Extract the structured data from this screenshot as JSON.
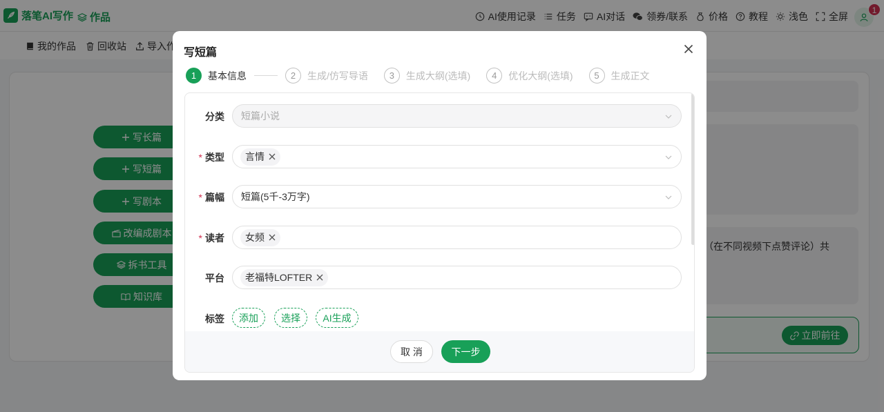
{
  "app": {
    "brand_name": "落笔AI写作",
    "works_label": "作品",
    "accent_color": "#18a058"
  },
  "topnav": {
    "items": [
      {
        "label": "AI使用记录",
        "icon": "clock-icon"
      },
      {
        "label": "任务",
        "icon": "list-icon"
      },
      {
        "label": "AI对话",
        "icon": "chat-icon"
      },
      {
        "label": "领券/联系",
        "icon": "wechat-icon"
      },
      {
        "label": "价格",
        "icon": "money-bag-icon"
      },
      {
        "label": "教程",
        "icon": "help-icon"
      },
      {
        "label": "浅色",
        "icon": "sun-icon"
      },
      {
        "label": "全屏",
        "icon": "fullscreen-icon"
      }
    ],
    "notification_count": "1"
  },
  "subbar": {
    "items": [
      {
        "label": "我的作品",
        "icon": "book-icon"
      },
      {
        "label": "回收站",
        "icon": "trash-icon"
      },
      {
        "label": "导入作",
        "icon": "upload-icon"
      }
    ]
  },
  "sidebar": {
    "buttons": [
      {
        "label": "写长篇",
        "icon": "plus-icon"
      },
      {
        "label": "写短篇",
        "icon": "plus-icon"
      },
      {
        "label": "写剧本",
        "icon": "plus-icon"
      },
      {
        "label": "改编成剧本",
        "icon": "clapper-icon"
      },
      {
        "label": "拆书工具",
        "icon": "layers-icon"
      },
      {
        "label": "知识库",
        "icon": "open-book-icon"
      }
    ]
  },
  "background": {
    "partial_text": "（在不同视频下点赞评论）共",
    "go_button": "立即前往"
  },
  "modal": {
    "title": "写短篇",
    "steps": [
      {
        "num": "1",
        "label": "基本信息",
        "active": true
      },
      {
        "num": "2",
        "label": "生成/仿写导语",
        "active": false
      },
      {
        "num": "3",
        "label": "生成大纲(选填)",
        "active": false
      },
      {
        "num": "4",
        "label": "优化大纲(选填)",
        "active": false
      },
      {
        "num": "5",
        "label": "生成正文",
        "active": false
      }
    ],
    "form": {
      "category": {
        "label": "分类",
        "value": "短篇小说"
      },
      "type": {
        "label": "类型",
        "required_mark": "*",
        "tag": "言情"
      },
      "length": {
        "label": "篇幅",
        "required_mark": "*",
        "value": "短篇(5千-3万字)"
      },
      "reader": {
        "label": "读者",
        "required_mark": "*",
        "tag": "女频"
      },
      "platform": {
        "label": "平台",
        "tag": "老福特LOFTER"
      },
      "tags": {
        "label": "标签",
        "add": "添加",
        "select": "选择",
        "ai_generate": "AI生成"
      }
    },
    "cancel_label": "取 消",
    "next_label": "下一步"
  }
}
